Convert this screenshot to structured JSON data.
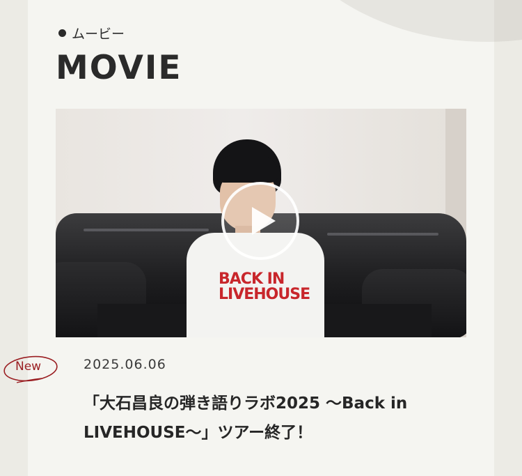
{
  "section": {
    "kana_label": "ムービー",
    "title": "MOVIE"
  },
  "movie": {
    "thumbnail_shirt_text": [
      "BACK IN",
      "LIVEHOUSE"
    ],
    "play_icon": "play-icon"
  },
  "post": {
    "badge": "New",
    "date": "2025.06.06",
    "title_line1": "「大石昌良の弾き語りラボ2025 〜Back in",
    "title_line2": "LIVEHOUSE〜」ツアー終了！"
  },
  "colors": {
    "page_bg": "#ecebe5",
    "panel_bg": "#f5f5f1",
    "badge": "#9a1e22",
    "text": "#262626"
  }
}
